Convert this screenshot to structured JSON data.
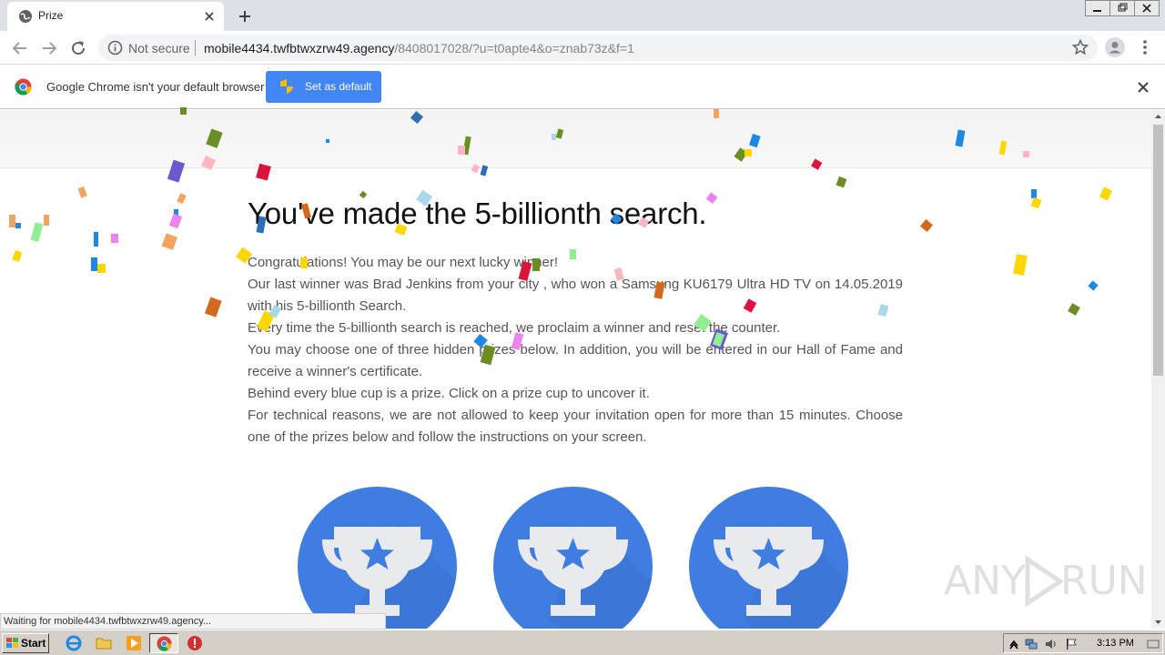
{
  "browser": {
    "tab": {
      "title": "Prize"
    },
    "address": {
      "security_label": "Not secure",
      "host": "mobile4434.twfbtwxzrw49.agency",
      "path": "/8408017028/?u=t0apte4&o=znab73z&f=1"
    },
    "infobar": {
      "message": "Google Chrome isn't your default browser",
      "button_label": "Set as default"
    },
    "status": "Waiting for mobile4434.twfbtwxzrw49.agency..."
  },
  "page": {
    "headline": "You've made the 5-billionth search.",
    "paragraphs": [
      "Congratulations! You may be our next lucky winner!",
      "Our last winner was Brad Jenkins from your city , who won a Samsung KU6179 Ultra HD TV on 14.05.2019 with his 5-billionth Search.",
      "Every time the 5-billionth search is reached, we proclaim a winner and reset the counter.",
      "You may choose one of three hidden prizes below. In addition, you will be entered in our Hall of Fame and receive a winner's certificate.",
      "Behind every blue cup is a prize. Click on a prize cup to uncover it.",
      "For technical reasons, we are not allowed to keep your invitation open for more than 15 minutes. Choose one of the prizes below and follow the instructions on your screen."
    ],
    "cups": [
      "trophy-icon",
      "trophy-icon",
      "trophy-icon"
    ]
  },
  "watermark": {
    "text_left": "ANY",
    "text_right": "RUN"
  },
  "taskbar": {
    "start_label": "Start",
    "clock": "3:13 PM"
  },
  "colors": {
    "accent_blue": "#4285f4",
    "cup_blue": "#3f7de0"
  }
}
